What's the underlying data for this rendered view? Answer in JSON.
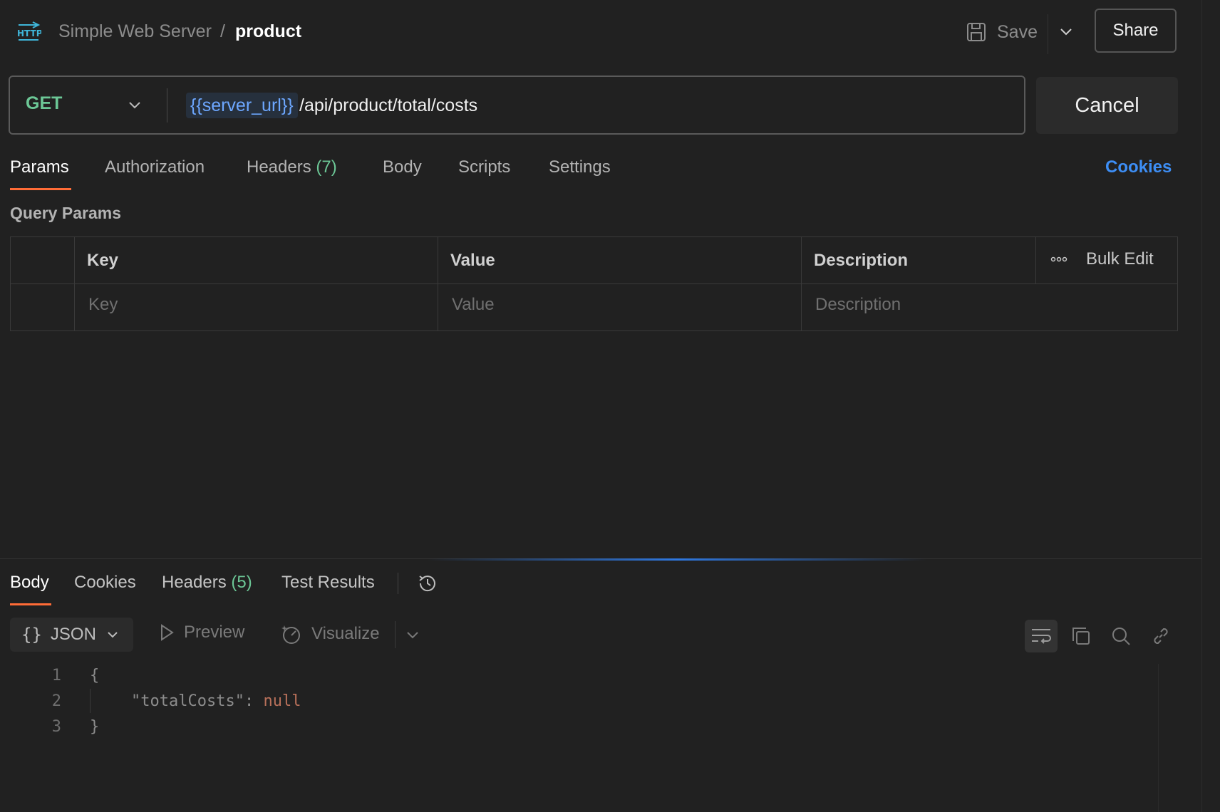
{
  "header": {
    "protocol_icon": "http-icon",
    "collection": "Simple Web Server",
    "separator": "/",
    "request_name": "product",
    "save_label": "Save",
    "share_label": "Share"
  },
  "request": {
    "method": "GET",
    "url_variable": "{{server_url}}",
    "url_path": "/api/product/total/costs",
    "cancel_label": "Cancel"
  },
  "request_tabs": {
    "params": "Params",
    "authorization": "Authorization",
    "headers": "Headers",
    "headers_count": "(7)",
    "body": "Body",
    "scripts": "Scripts",
    "settings": "Settings",
    "cookies": "Cookies",
    "active": "Params"
  },
  "query_params": {
    "title": "Query Params",
    "columns": [
      "Key",
      "Value",
      "Description"
    ],
    "bulk_edit": "Bulk Edit",
    "placeholders": {
      "key": "Key",
      "value": "Value",
      "description": "Description"
    }
  },
  "response_tabs": {
    "body": "Body",
    "cookies": "Cookies",
    "headers": "Headers",
    "headers_count": "(5)",
    "test_results": "Test Results",
    "active": "Body"
  },
  "response_toolbar": {
    "format": "JSON",
    "preview": "Preview",
    "visualize": "Visualize"
  },
  "response_body": {
    "line_numbers": [
      "1",
      "2",
      "3"
    ],
    "open_brace": "{",
    "key": "\"totalCosts\"",
    "colon": ": ",
    "value": "null",
    "close_brace": "}"
  },
  "colors": {
    "background": "#212121",
    "method_get": "#6cc796",
    "accent_orange": "#ff6c37",
    "link_blue": "#3d8ef5",
    "variable_blue": "#6da7ff"
  }
}
